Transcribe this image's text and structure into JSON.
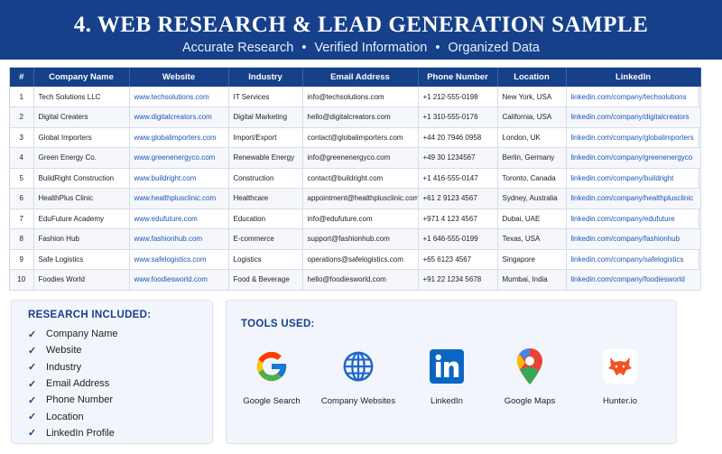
{
  "header": {
    "title": "4. WEB RESEARCH & LEAD GENERATION SAMPLE",
    "subtitle_parts": [
      "Accurate Research",
      "Verified Information",
      "Organized Data"
    ],
    "separator": "•"
  },
  "table": {
    "columns": [
      "#",
      "Company Name",
      "Website",
      "Industry",
      "Email Address",
      "Phone Number",
      "Location",
      "LinkedIn"
    ],
    "rows": [
      [
        "1",
        "Tech Solutions LLC",
        "www.techsolutions.com",
        "IT Services",
        "info@techsolutions.com",
        "+1 212-555-0198",
        "New York, USA",
        "linkedin.com/company/techsolutions"
      ],
      [
        "2",
        "Digital Creaters",
        "www.digitalcreators.com",
        "Digital Marketing",
        "hello@digitalcreators.com",
        "+1 310-555-0176",
        "California, USA",
        "linkedin.com/company/digitalcreators"
      ],
      [
        "3",
        "Global Importers",
        "www.globalimporters.com",
        "Import/Export",
        "contact@globalimporters.com",
        "+44 20 7946 0958",
        "London, UK",
        "linkedin.com/company/globalimporters"
      ],
      [
        "4",
        "Green Energy Co.",
        "www.greenenergyco.com",
        "Renewable Energy",
        "info@greenenergyco.com",
        "+49 30 1234567",
        "Berlin, Germany",
        "linkedin.com/company/greenenergyco"
      ],
      [
        "5",
        "BuildRight Construction",
        "www.buildright.com",
        "Construction",
        "contact@buildright.com",
        "+1 416-555-0147",
        "Toronto, Canada",
        "linkedin.com/company/buildright"
      ],
      [
        "6",
        "HealthPlus Clinic",
        "www.healthplusclinic.com",
        "Healthcare",
        "appointment@healthplusclinic.com",
        "+61 2 9123 4567",
        "Sydney, Australia",
        "linkedin.com/company/healthplusclinic"
      ],
      [
        "7",
        "EduFuture Academy",
        "www.edufuture.com",
        "Education",
        "info@edufuture.com",
        "+971 4 123 4567",
        "Dubai, UAE",
        "linkedin.com/company/edufuture"
      ],
      [
        "8",
        "Fashion Hub",
        "www.fashionhub.com",
        "E-commerce",
        "support@fashionhub.com",
        "+1 646-555-0199",
        "Texas, USA",
        "linkedin.com/company/fashionhub"
      ],
      [
        "9",
        "Safe Logistics",
        "www.safelogistics.com",
        "Logistics",
        "operations@safelogistics.com",
        "+65 6123 4567",
        "Singapore",
        "linkedin.com/company/safelogistics"
      ],
      [
        "10",
        "Foodies World",
        "www.foodiesworld.com",
        "Food & Beverage",
        "hello@foodiesworld.com",
        "+91 22 1234 5678",
        "Mumbai, India",
        "linkedin.com/company/foodiesworld"
      ]
    ]
  },
  "research": {
    "title": "RESEARCH INCLUDED:",
    "items": [
      "Company Name",
      "Website",
      "Industry",
      "Email Address",
      "Phone Number",
      "Location",
      "LinkedIn Profile"
    ]
  },
  "tools": {
    "title": "TOOLS USED:",
    "items": [
      {
        "label": "Google Search",
        "icon": "google-icon"
      },
      {
        "label": "Company Websites",
        "icon": "globe-icon"
      },
      {
        "label": "LinkedIn",
        "icon": "linkedin-icon"
      },
      {
        "label": "Google Maps",
        "icon": "map-pin-icon"
      },
      {
        "label": "Hunter.io",
        "icon": "hunter-fox-icon"
      }
    ]
  },
  "colors": {
    "primary": "#16408a",
    "link": "#1f55b6",
    "panel": "#f2f5fb"
  }
}
